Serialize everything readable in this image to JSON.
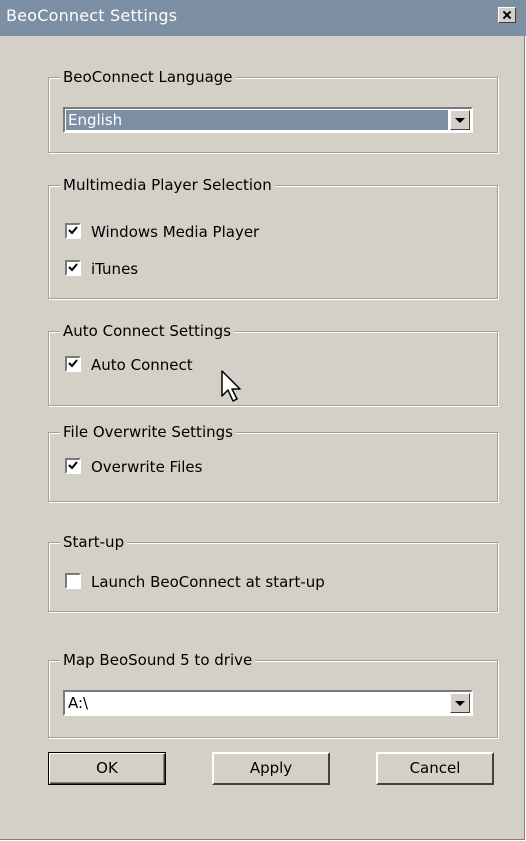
{
  "window": {
    "title": "BeoConnect Settings"
  },
  "language": {
    "group_label": "BeoConnect Language",
    "selected": "English"
  },
  "player": {
    "group_label": "Multimedia Player Selection",
    "options": [
      {
        "label": "Windows Media Player",
        "checked": true
      },
      {
        "label": "iTunes",
        "checked": true
      }
    ]
  },
  "auto_connect": {
    "group_label": "Auto Connect Settings",
    "label": "Auto Connect",
    "checked": true
  },
  "overwrite": {
    "group_label": "File Overwrite Settings",
    "label": "Overwrite Files",
    "checked": true
  },
  "startup": {
    "group_label": "Start-up",
    "label": "Launch BeoConnect at start-up",
    "checked": false
  },
  "drive": {
    "group_label": "Map BeoSound 5 to drive",
    "selected": "A:\\"
  },
  "buttons": {
    "ok": "OK",
    "apply": "Apply",
    "cancel": "Cancel"
  },
  "colors": {
    "titlebar": "#7d8fa3",
    "dialog": "#d4d0c8",
    "selection": "#7d8fa3"
  }
}
